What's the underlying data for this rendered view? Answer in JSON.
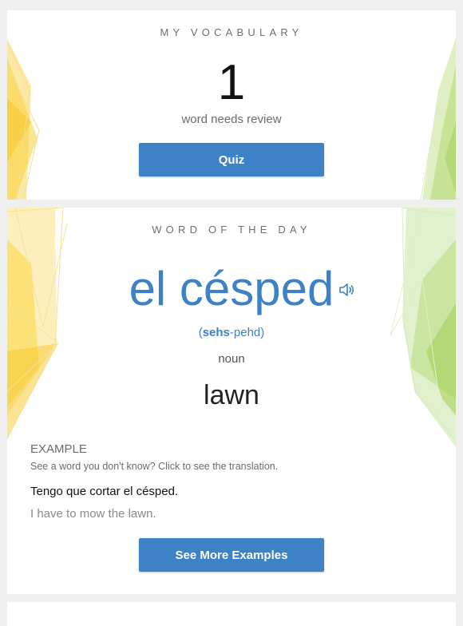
{
  "vocabulary": {
    "heading": "MY VOCABULARY",
    "count": "1",
    "review_text": "word needs review",
    "quiz_button": "Quiz"
  },
  "word_of_the_day": {
    "heading": "WORD OF THE DAY",
    "word": "el césped",
    "pronunciation_stressed": "sehs",
    "pronunciation_rest": "-pehd",
    "pronunciation_open": "(",
    "pronunciation_close": ")",
    "part_of_speech": "noun",
    "translation": "lawn",
    "speaker_icon": "speaker-icon",
    "example": {
      "heading": "EXAMPLE",
      "hint": "See a word you don't know? Click to see the translation.",
      "sentence": "Tengo que cortar el césped.",
      "sentence_translation": "I have to mow the lawn."
    },
    "more_button": "See More Examples"
  },
  "colors": {
    "accent": "#3d82c6",
    "yellow_deco": "#f9d54a",
    "green_deco": "#a9d46a",
    "background": "#efefef"
  }
}
